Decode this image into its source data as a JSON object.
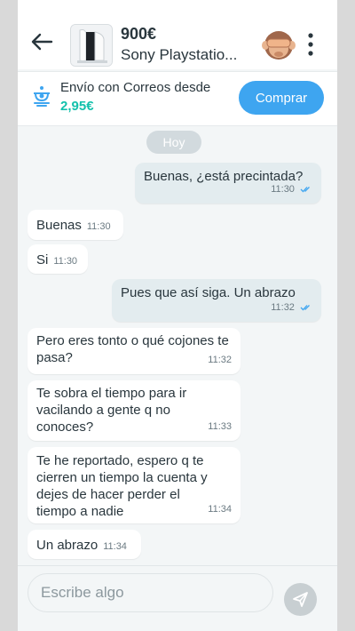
{
  "header": {
    "price": "900€",
    "title": "Sony Playstatio...",
    "back_icon": "arrow-left-icon",
    "menu_icon": "more-vertical-icon"
  },
  "shipping": {
    "icon": "correos-post-horn-icon",
    "text": "Envío con Correos desde",
    "price": "2,95€",
    "buy_label": "Comprar"
  },
  "chat": {
    "day_label": "Hoy",
    "messages": [
      {
        "from": "me",
        "text": "Buenas, ¿está precintada?",
        "time": "11:30",
        "read": true
      },
      {
        "from": "them",
        "text": "Buenas",
        "time": "11:30"
      },
      {
        "from": "them",
        "text": "Si",
        "time": "11:30"
      },
      {
        "from": "me",
        "text": "Pues que así siga. Un abrazo",
        "time": "11:32",
        "read": true
      },
      {
        "from": "them",
        "text": "Pero eres tonto o qué cojones te pasa?",
        "time": "11:32"
      },
      {
        "from": "them",
        "text": "Te sobra el tiempo para ir vacilando a gente q no conoces?",
        "time": "11:33"
      },
      {
        "from": "them",
        "text": "Te he reportado, espero q te cierren un tiempo la cuenta y dejes de hacer perder el tiempo a nadie",
        "time": "11:34"
      },
      {
        "from": "them",
        "text": "Un abrazo",
        "time": "11:34"
      }
    ]
  },
  "composer": {
    "placeholder": "Escribe algo",
    "send_icon": "send-icon"
  },
  "colors": {
    "accent": "#13c1ac",
    "buy_button": "#3ea5f0",
    "outgoing_bubble": "#e3ecef",
    "incoming_bubble": "#ffffff",
    "read_ticks": "#3ea5f0"
  }
}
